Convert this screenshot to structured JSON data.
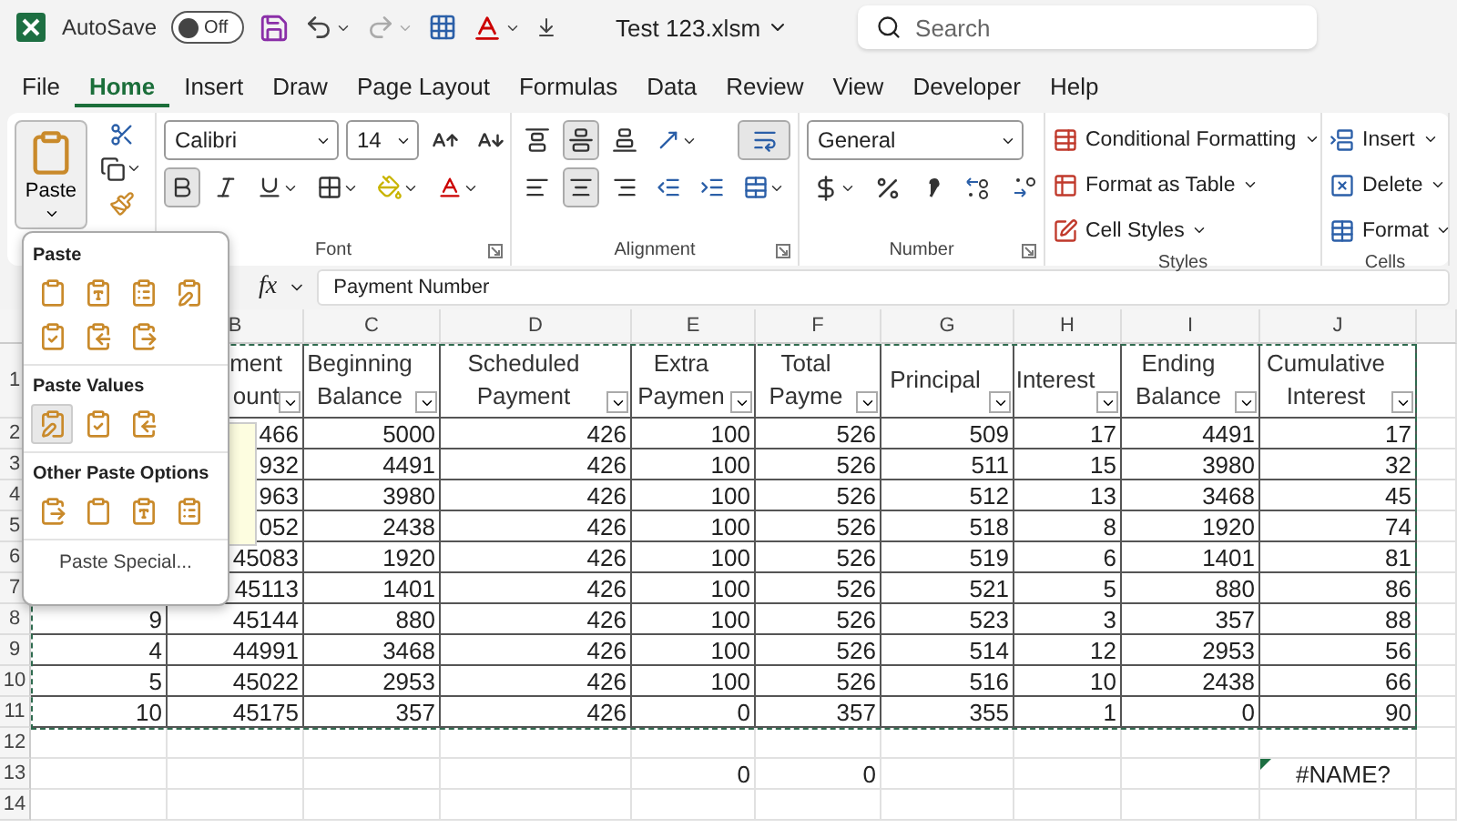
{
  "title_bar": {
    "autosave": {
      "label": "AutoSave",
      "state_label": "Off",
      "on": false
    },
    "file_name": "Test 123.xlsm",
    "search": {
      "placeholder": "Search"
    }
  },
  "tabs": [
    {
      "label": "File",
      "selected": false
    },
    {
      "label": "Home",
      "selected": true
    },
    {
      "label": "Insert",
      "selected": false
    },
    {
      "label": "Draw",
      "selected": false
    },
    {
      "label": "Page Layout",
      "selected": false
    },
    {
      "label": "Formulas",
      "selected": false
    },
    {
      "label": "Data",
      "selected": false
    },
    {
      "label": "Review",
      "selected": false
    },
    {
      "label": "View",
      "selected": false
    },
    {
      "label": "Developer",
      "selected": false
    },
    {
      "label": "Help",
      "selected": false
    }
  ],
  "ribbon": {
    "paste_button": "Paste",
    "font": {
      "name": "Calibri",
      "size": "14",
      "bold": true,
      "italic": false,
      "underline": false,
      "label": "Font"
    },
    "alignment": {
      "vertical": [
        {
          "kind": "top",
          "active": false
        },
        {
          "kind": "middle",
          "active": true
        },
        {
          "kind": "bottom",
          "active": false
        }
      ],
      "horizontal": [
        {
          "kind": "left",
          "active": false
        },
        {
          "kind": "center",
          "active": true
        },
        {
          "kind": "right",
          "active": false
        }
      ],
      "label": "Alignment"
    },
    "number": {
      "format": "General",
      "label": "Number"
    },
    "styles": {
      "items": [
        "Conditional Formatting",
        "Format as Table",
        "Cell Styles"
      ],
      "label": "Styles"
    },
    "cells": {
      "items": [
        "Insert",
        "Delete",
        "Format"
      ],
      "label": "Cells"
    }
  },
  "formula_bar": {
    "fx": "fx",
    "value": "Payment Number"
  },
  "paste_menu": {
    "sections": [
      {
        "title": "Paste",
        "options": [
          {
            "selected": false
          },
          {
            "selected": false
          },
          {
            "selected": false
          },
          {
            "selected": false
          },
          {
            "selected": false
          },
          {
            "selected": false
          },
          {
            "selected": false
          }
        ]
      },
      {
        "title": "Paste Values",
        "options": [
          {
            "selected": true
          },
          {
            "selected": false
          },
          {
            "selected": false
          }
        ]
      },
      {
        "title": "Other Paste Options",
        "options": [
          {
            "selected": false
          },
          {
            "selected": false
          },
          {
            "selected": false
          },
          {
            "selected": false
          }
        ]
      }
    ],
    "footer": "Paste Special..."
  },
  "sheet": {
    "columns": [
      null,
      "B",
      "C",
      "D",
      "E",
      "F",
      "G",
      "H",
      "I",
      "J"
    ],
    "headers": [
      {
        "lines": [
          "ment",
          "ount"
        ]
      },
      {
        "lines": [
          "Beginning",
          "Balance"
        ]
      },
      {
        "lines": [
          "Scheduled",
          "Payment"
        ]
      },
      {
        "lines": [
          "Extra",
          "Paymen"
        ]
      },
      {
        "lines": [
          "Total",
          "Payme"
        ]
      },
      {
        "lines": [
          "Principal"
        ]
      },
      {
        "lines": [
          "Interest"
        ]
      },
      {
        "lines": [
          "Ending",
          "Balance"
        ]
      },
      {
        "lines": [
          "Cumulative",
          "Interest"
        ]
      }
    ],
    "rows": [
      {
        "number": "1"
      },
      {
        "number": "2",
        "cells": [
          null,
          "466",
          "5000",
          "426",
          "100",
          "526",
          "509",
          "17",
          "4491",
          "17"
        ]
      },
      {
        "number": "3",
        "cells": [
          null,
          "932",
          "4491",
          "426",
          "100",
          "526",
          "511",
          "15",
          "3980",
          "32"
        ]
      },
      {
        "number": "4",
        "cells": [
          null,
          "963",
          "3980",
          "426",
          "100",
          "526",
          "512",
          "13",
          "3468",
          "45"
        ]
      },
      {
        "number": "5",
        "cells": [
          null,
          "052",
          "2438",
          "426",
          "100",
          "526",
          "518",
          "8",
          "1920",
          "74"
        ]
      },
      {
        "number": "6",
        "cells": [
          null,
          "45083",
          "1920",
          "426",
          "100",
          "526",
          "519",
          "6",
          "1401",
          "81"
        ]
      },
      {
        "number": "7",
        "cells": [
          null,
          "45113",
          "1401",
          "426",
          "100",
          "526",
          "521",
          "5",
          "880",
          "86"
        ]
      },
      {
        "number": "8",
        "cells": [
          "9",
          "45144",
          "880",
          "426",
          "100",
          "526",
          "523",
          "3",
          "357",
          "88"
        ]
      },
      {
        "number": "9",
        "cells": [
          "4",
          "44991",
          "3468",
          "426",
          "100",
          "526",
          "514",
          "12",
          "2953",
          "56"
        ]
      },
      {
        "number": "10",
        "cells": [
          "5",
          "45022",
          "2953",
          "426",
          "100",
          "526",
          "516",
          "10",
          "2438",
          "66"
        ]
      },
      {
        "number": "11",
        "cells": [
          "10",
          "45175",
          "357",
          "426",
          "0",
          "357",
          "355",
          "1",
          "0",
          "90"
        ]
      },
      {
        "number": "12"
      },
      {
        "number": "13",
        "cells": [
          null,
          null,
          null,
          null,
          "0",
          "0",
          null,
          null,
          null,
          "#NAME?"
        ],
        "error_indicator": true
      },
      {
        "number": "14"
      }
    ]
  }
}
